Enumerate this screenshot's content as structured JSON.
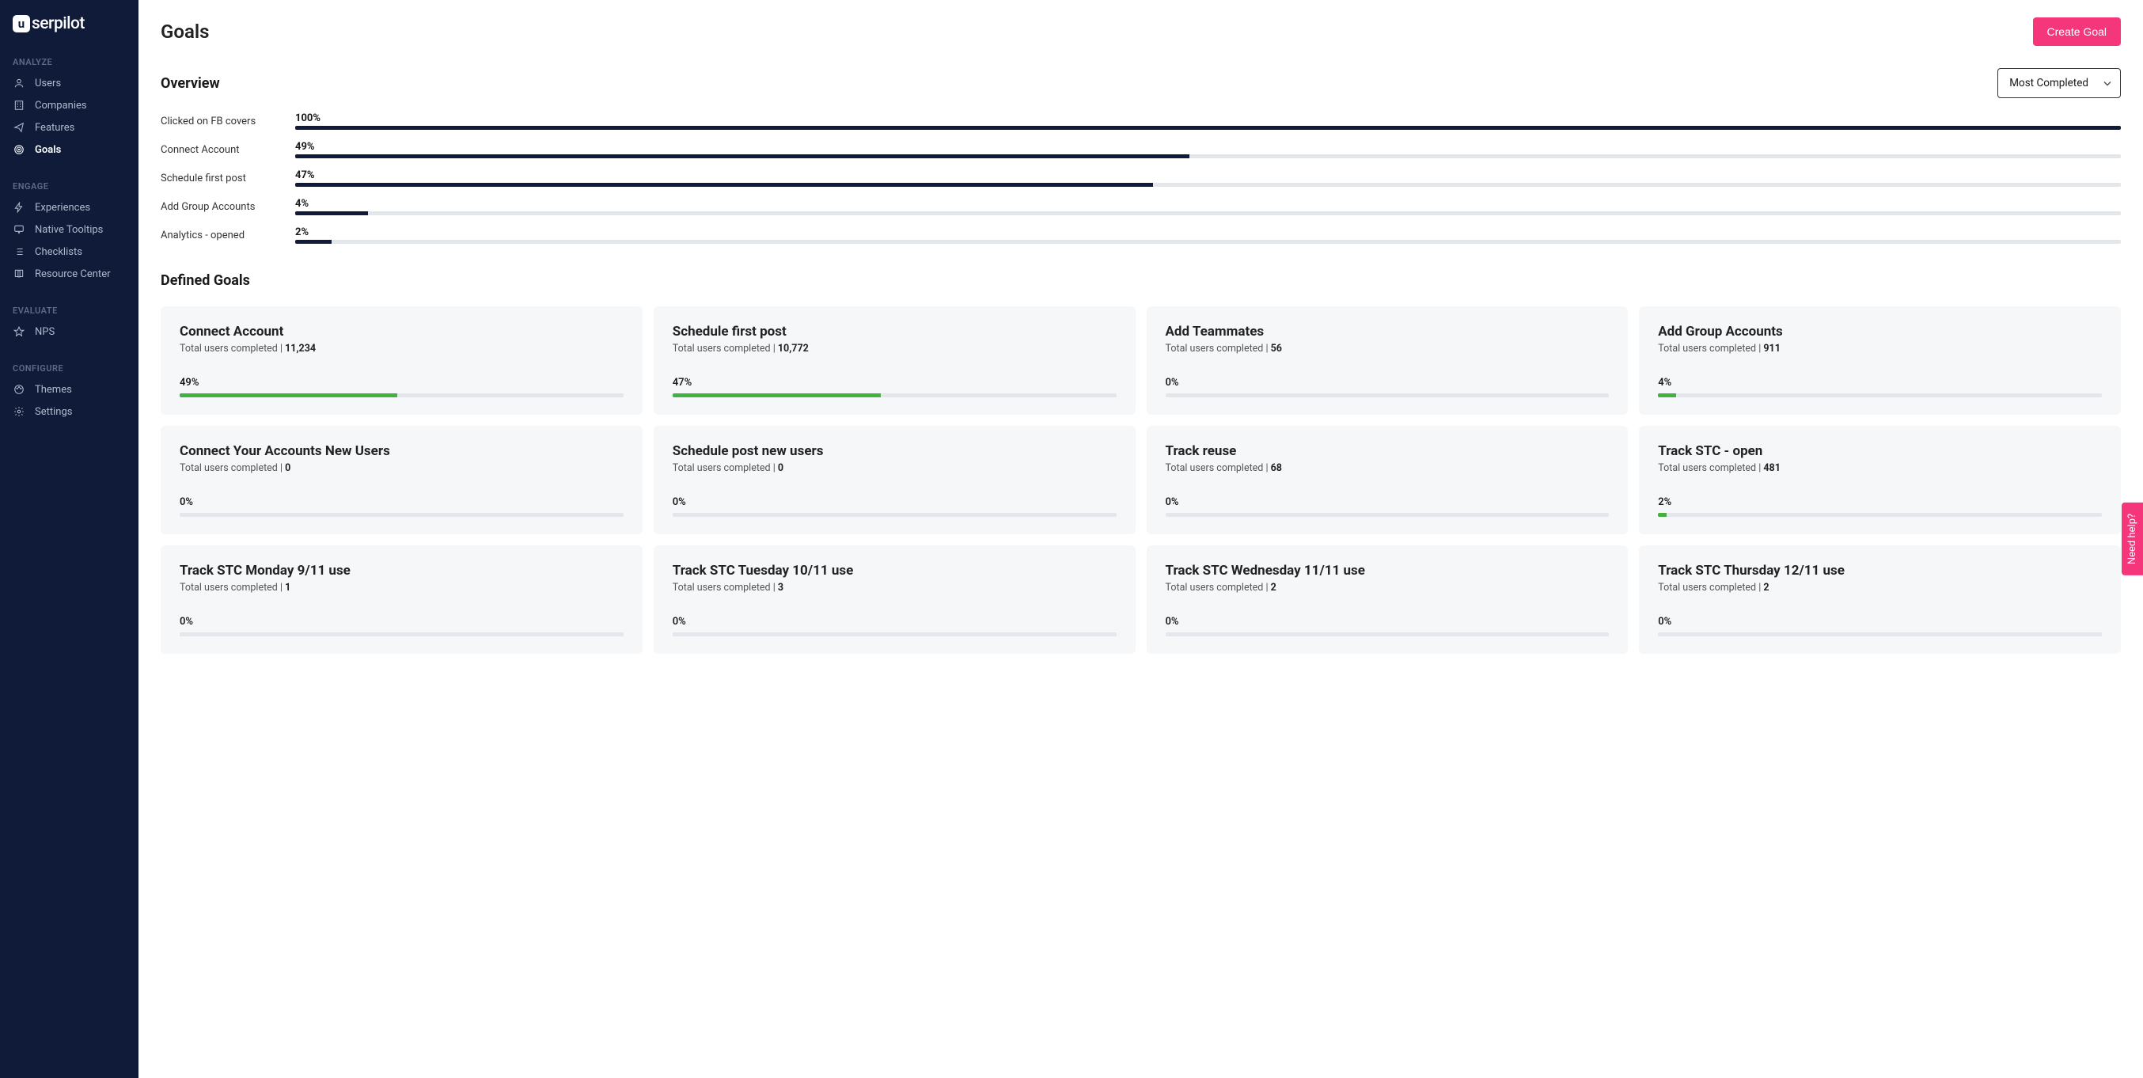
{
  "brand": "serpilot",
  "page_title": "Goals",
  "create_button": "Create Goal",
  "sort_select": "Most Completed",
  "overview_heading": "Overview",
  "defined_heading": "Defined Goals",
  "total_label": "Total users completed",
  "help_label": "Need help?",
  "sidebar": {
    "sections": [
      {
        "header": "ANALYZE",
        "items": [
          {
            "label": "Users",
            "icon": "user"
          },
          {
            "label": "Companies",
            "icon": "building"
          },
          {
            "label": "Features",
            "icon": "send"
          },
          {
            "label": "Goals",
            "icon": "target",
            "active": true
          }
        ]
      },
      {
        "header": "ENGAGE",
        "items": [
          {
            "label": "Experiences",
            "icon": "bolt"
          },
          {
            "label": "Native Tooltips",
            "icon": "tooltip"
          },
          {
            "label": "Checklists",
            "icon": "list"
          },
          {
            "label": "Resource Center",
            "icon": "book"
          }
        ]
      },
      {
        "header": "EVALUATE",
        "items": [
          {
            "label": "NPS",
            "icon": "star"
          }
        ]
      },
      {
        "header": "CONFIGURE",
        "items": [
          {
            "label": "Themes",
            "icon": "palette"
          },
          {
            "label": "Settings",
            "icon": "gear"
          }
        ]
      }
    ]
  },
  "overview": [
    {
      "label": "Clicked on FB covers",
      "pct": 100
    },
    {
      "label": "Connect Account",
      "pct": 49
    },
    {
      "label": "Schedule first post",
      "pct": 47
    },
    {
      "label": "Add Group Accounts",
      "pct": 4
    },
    {
      "label": "Analytics - opened",
      "pct": 2
    }
  ],
  "goals": [
    {
      "title": "Connect Account",
      "count": "11,234",
      "pct": 49
    },
    {
      "title": "Schedule first post",
      "count": "10,772",
      "pct": 47
    },
    {
      "title": "Add Teammates",
      "count": "56",
      "pct": 0
    },
    {
      "title": "Add Group Accounts",
      "count": "911",
      "pct": 4
    },
    {
      "title": "Connect Your Accounts New Users",
      "count": "0",
      "pct": 0
    },
    {
      "title": "Schedule post new users",
      "count": "0",
      "pct": 0
    },
    {
      "title": "Track reuse",
      "count": "68",
      "pct": 0
    },
    {
      "title": "Track STC - open",
      "count": "481",
      "pct": 2
    },
    {
      "title": "Track STC Monday 9/11 use",
      "count": "1",
      "pct": 0
    },
    {
      "title": "Track STC Tuesday 10/11 use",
      "count": "3",
      "pct": 0
    },
    {
      "title": "Track STC Wednesday 11/11 use",
      "count": "2",
      "pct": 0
    },
    {
      "title": "Track STC Thursday 12/11 use",
      "count": "2",
      "pct": 0
    }
  ]
}
